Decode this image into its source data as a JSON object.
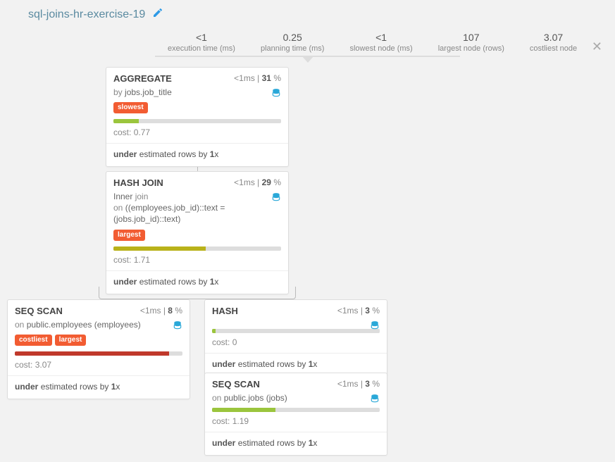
{
  "title": "sql-joins-hr-exercise-19",
  "stats": [
    {
      "val": "<1",
      "lbl": "execution time (ms)"
    },
    {
      "val": "0.25",
      "lbl": "planning time (ms)"
    },
    {
      "val": "<1",
      "lbl": "slowest node (ms)"
    },
    {
      "val": "107",
      "lbl": "largest node (rows)"
    },
    {
      "val": "3.07",
      "lbl": "costliest node"
    }
  ],
  "nodes": {
    "agg": {
      "name": "AGGREGATE",
      "time": "<1",
      "pct": "31",
      "by_lbl": "by",
      "by": "jobs.job_title",
      "badge1": "slowest",
      "bar_pct": 15,
      "cost_lbl": "cost:",
      "cost": "0.77",
      "est_a": "under",
      "est_b": "estimated rows by",
      "est_x": "1",
      "est_c": "x"
    },
    "hj": {
      "name": "HASH JOIN",
      "time": "<1",
      "pct": "29",
      "jk": "Inner",
      "jk2": "join",
      "on_lbl": "on",
      "on": "((employees.job_id)::text = (jobs.job_id)::text)",
      "badge1": "largest",
      "bar_pct": 55,
      "cost_lbl": "cost:",
      "cost": "1.71",
      "est_a": "under",
      "est_b": "estimated rows by",
      "est_x": "1",
      "est_c": "x"
    },
    "ss1": {
      "name": "SEQ SCAN",
      "time": "<1",
      "pct": "8",
      "on_lbl": "on",
      "on": "public.employees (employees)",
      "badge1": "costliest",
      "badge2": "largest",
      "bar_pct": 92,
      "cost_lbl": "cost:",
      "cost": "3.07",
      "est_a": "under",
      "est_b": "estimated rows by",
      "est_x": "1",
      "est_c": "x"
    },
    "hash": {
      "name": "HASH",
      "time": "<1",
      "pct": "3",
      "bar_pct": 2,
      "cost_lbl": "cost:",
      "cost": "0",
      "est_a": "under",
      "est_b": "estimated rows by",
      "est_x": "1",
      "est_c": "x"
    },
    "ss2": {
      "name": "SEQ SCAN",
      "time": "<1",
      "pct": "3",
      "on_lbl": "on",
      "on": "public.jobs (jobs)",
      "bar_pct": 38,
      "cost_lbl": "cost:",
      "cost": "1.19",
      "est_a": "under",
      "est_b": "estimated rows by",
      "est_x": "1",
      "est_c": "x"
    }
  },
  "ms_suffix": "ms",
  "pct_suffix": " %"
}
